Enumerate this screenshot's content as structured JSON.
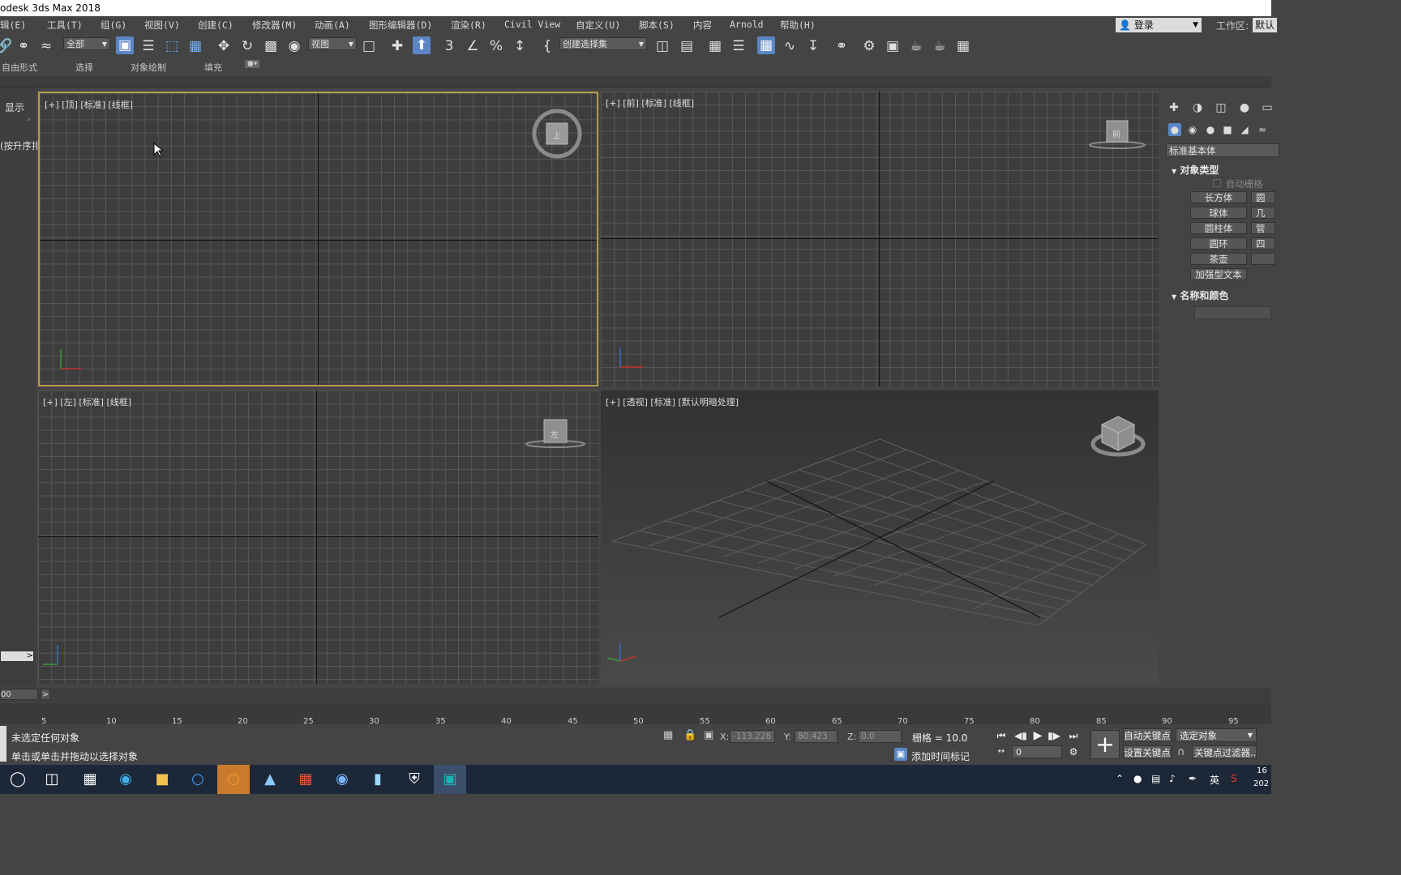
{
  "window": {
    "title": "odesk 3ds Max 2018"
  },
  "menubar": {
    "items": [
      "辑(E)",
      "工具(T)",
      "组(G)",
      "视图(V)",
      "创建(C)",
      "修改器(M)",
      "动画(A)",
      "图形编辑器(D)",
      "渲染(R)",
      "Civil View",
      "自定义(U)",
      "脚本(S)",
      "内容",
      "Arnold",
      "帮助(H)"
    ],
    "login": "登录",
    "workspace_label": "工作区:",
    "workspace_value": "默认"
  },
  "toolbar": {
    "filter_combo": "全部",
    "view_combo": "视图",
    "selection_set_combo": "创建选择集",
    "snap_label": "3"
  },
  "ribbon": {
    "tabs": [
      "自由形式",
      "选择",
      "对象绘制",
      "填充"
    ]
  },
  "left_panel": {
    "display_tab": "显示",
    "sort_label": "(按升序排"
  },
  "viewports": {
    "top": {
      "label": "[+] [顶] [标准] [线框]",
      "viewcube_face": "上"
    },
    "front": {
      "label": "[+] [前] [标准] [线框]",
      "viewcube_face": "前"
    },
    "left": {
      "label": "[+] [左] [标准] [线框]",
      "viewcube_face": "左"
    },
    "perspective": {
      "label": "[+] [透视] [标准] [默认明暗处理]"
    }
  },
  "command_panel": {
    "category_combo": "标准基本体",
    "object_type_title": "对象类型",
    "auto_grid": "自动栅格",
    "buttons": [
      "长方体",
      "球体",
      "圆柱体",
      "圆环",
      "茶壶",
      "加强型文本"
    ],
    "partial_buttons": [
      "圆",
      "几",
      "管",
      "四",
      ""
    ],
    "name_color_title": "名称和颜色"
  },
  "timeline": {
    "slider_value": "00",
    "ticks": [
      "5",
      "10",
      "15",
      "20",
      "25",
      "30",
      "35",
      "40",
      "45",
      "50",
      "55",
      "60",
      "65",
      "70",
      "75",
      "80",
      "85",
      "90",
      "95"
    ]
  },
  "status": {
    "message1": "未选定任何对象",
    "message2": "单击或单击并拖动以选择对象",
    "x_label": "X:",
    "x_value": "-113.228",
    "y_label": "Y:",
    "y_value": "80.423",
    "z_label": "Z:",
    "z_value": "0.0",
    "grid": "栅格 = 10.0",
    "add_time_marker": "添加时间标记",
    "auto_key": "自动关键点",
    "set_key": "设置关键点",
    "selected_object": "选定对象",
    "key_filter": "关键点过滤器...",
    "frame": "0"
  },
  "taskbar": {
    "ime": "英",
    "clock_time": "16",
    "clock_date": "202"
  },
  "colors": {
    "active_viewport_border": "#b69c4c",
    "accent_blue": "#5b86c5",
    "taskbar": "#1c2838"
  }
}
